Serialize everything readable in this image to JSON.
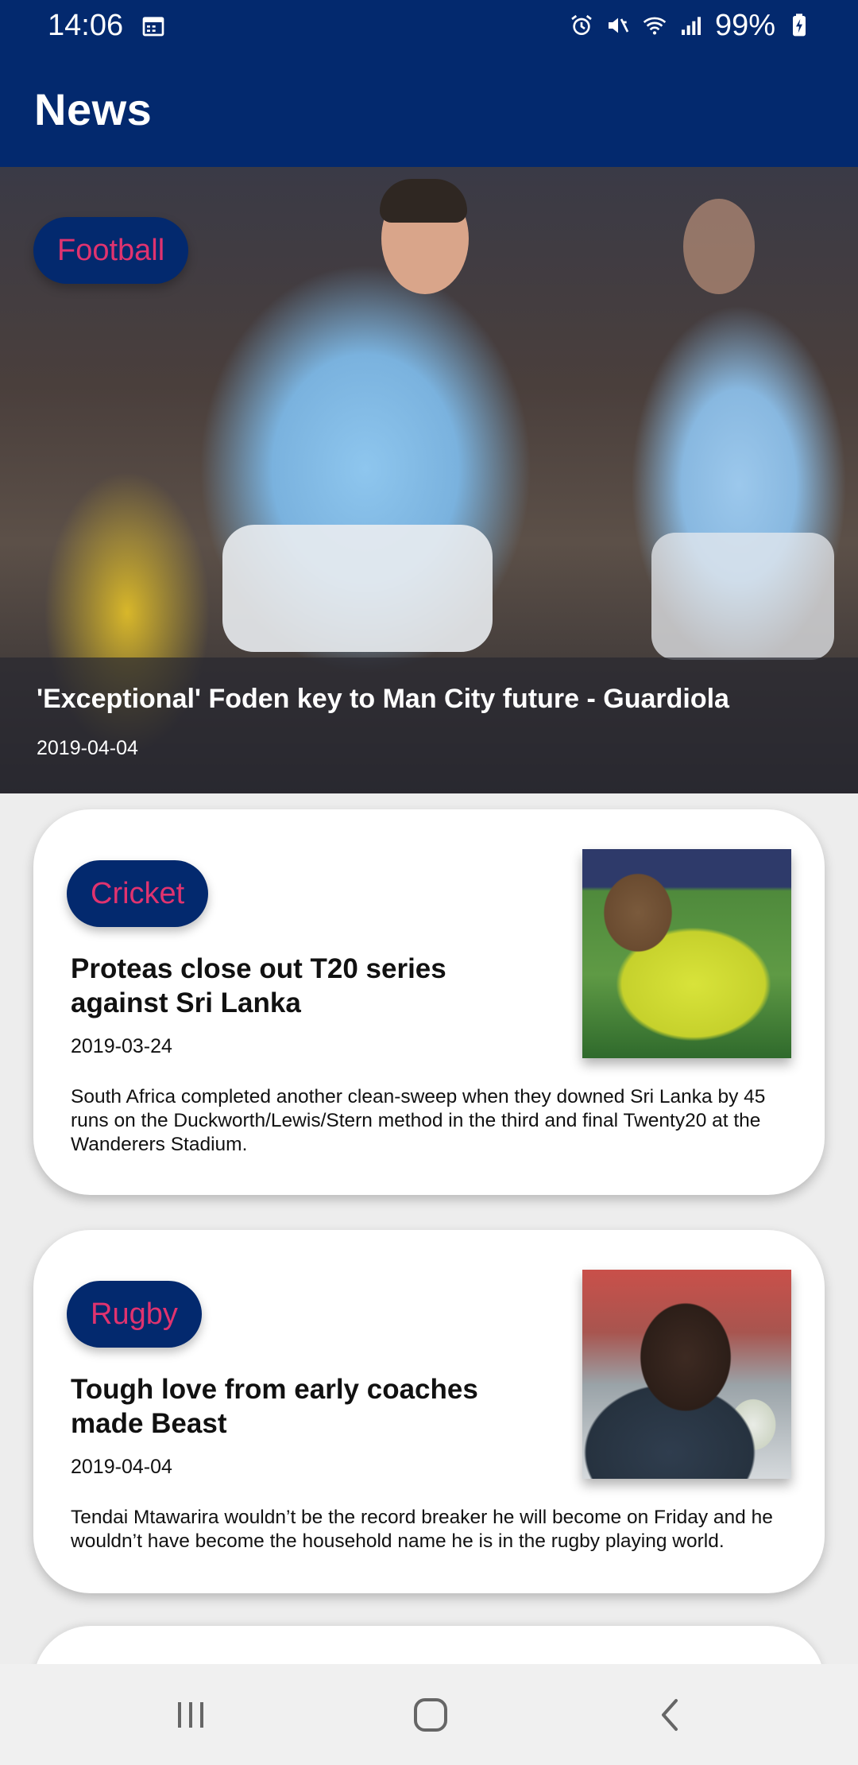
{
  "status_bar": {
    "time": "14:06",
    "battery": "99%",
    "icons": [
      "calendar-icon",
      "alarm-icon",
      "mute-icon",
      "wifi-icon",
      "signal-icon",
      "battery-icon"
    ]
  },
  "app_bar": {
    "title": "News"
  },
  "featured": {
    "category": "Football",
    "title": "'Exceptional' Foden key to Man City future - Guardiola",
    "date": "2019-04-04"
  },
  "articles": [
    {
      "category": "Cricket",
      "title": "Proteas close out T20 series against Sri Lanka",
      "date": "2019-03-24",
      "summary": "South Africa completed another clean-sweep when they downed Sri Lanka by 45 runs on the Duckworth/Lewis/Stern method in the third and final Twenty20 at the Wanderers Stadium."
    },
    {
      "category": "Rugby",
      "title": "Tough love from early coaches made Beast",
      "date": "2019-04-04",
      "summary": "Tendai Mtawarira wouldn’t be the record breaker he will become on Friday and he wouldn’t have become the household name he is in the rugby playing world."
    }
  ],
  "colors": {
    "primary": "#03296e",
    "chip_text": "#e0336f",
    "background": "#ededed"
  },
  "nav_bar": {
    "icons": [
      "recents-icon",
      "home-icon",
      "back-icon"
    ]
  }
}
